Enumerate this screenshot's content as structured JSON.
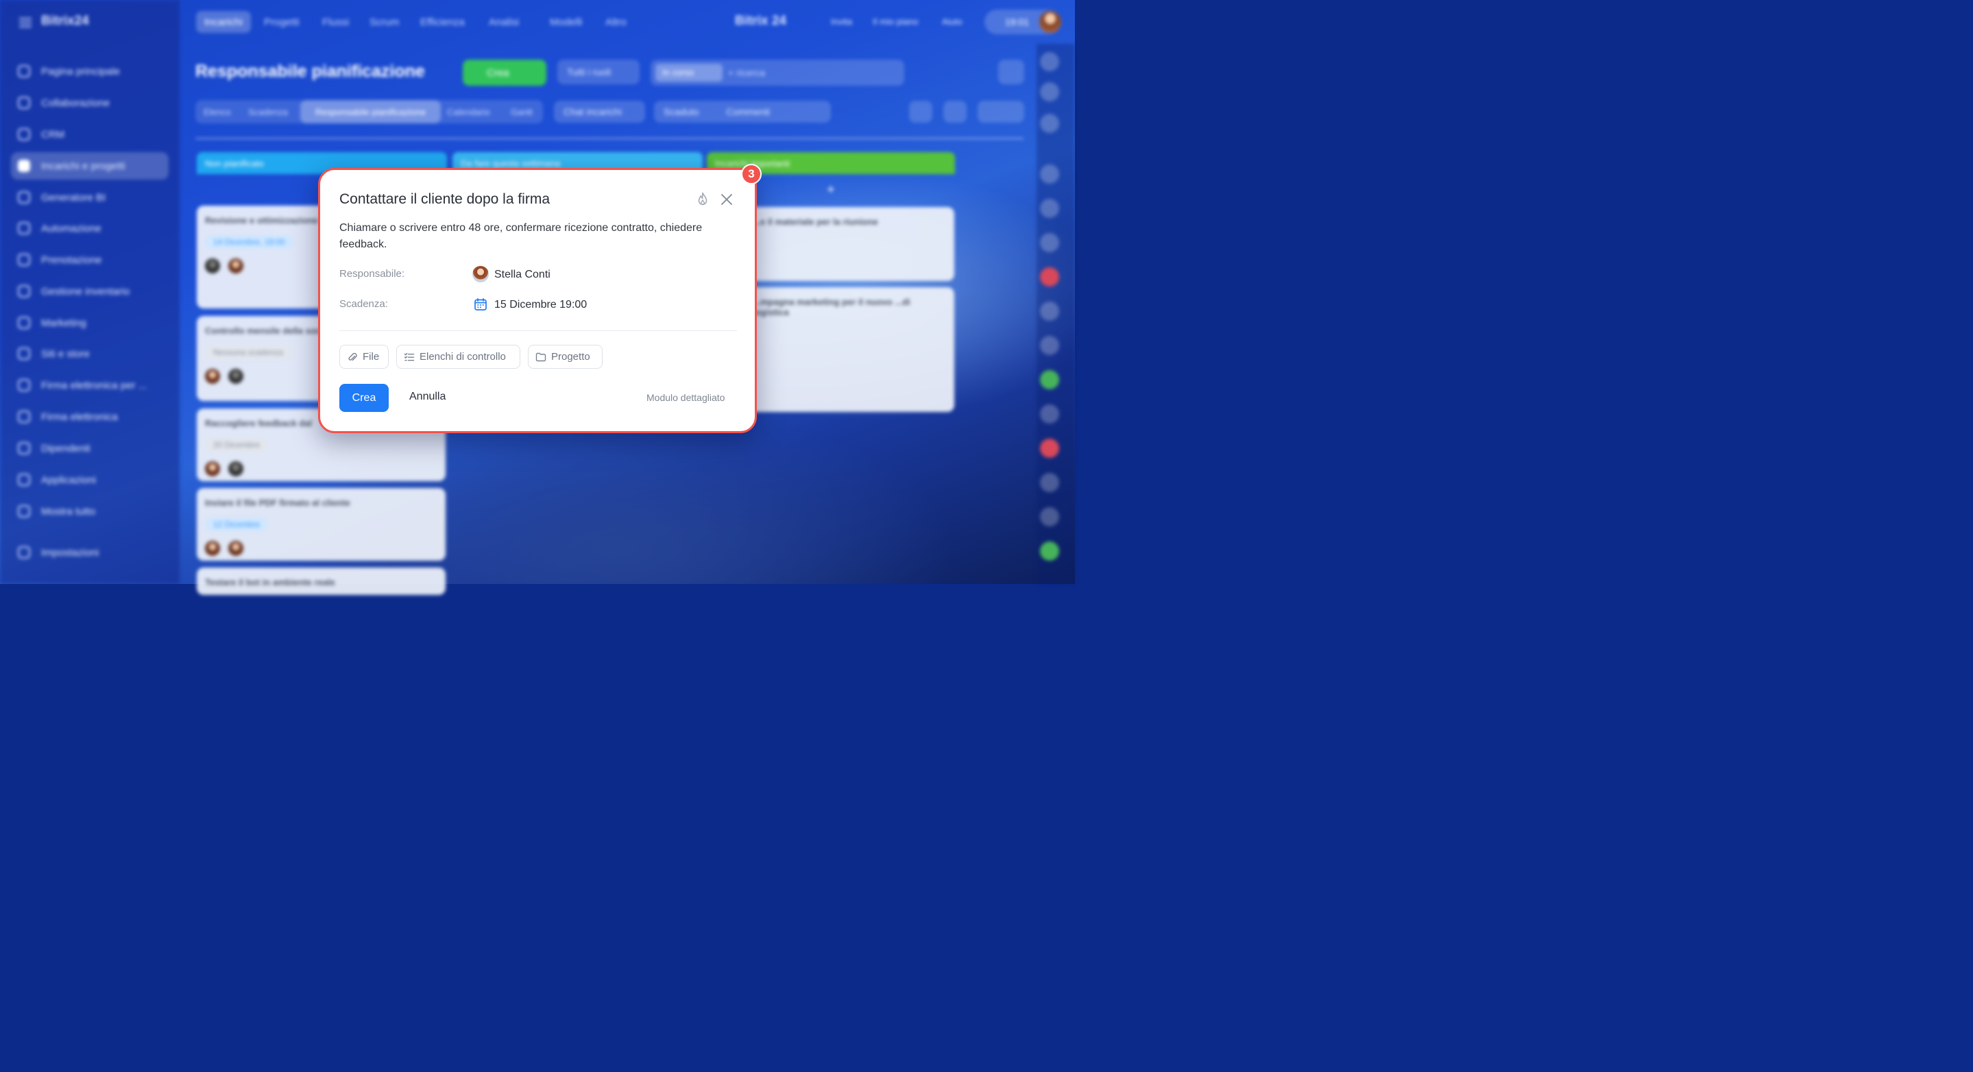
{
  "app": {
    "logo": "Bitrix24",
    "top_tabs": [
      "Incarichi",
      "Progetti",
      "Flussi",
      "Scrum",
      "Efficienza",
      "Analisi",
      "Modelli",
      "Altro"
    ],
    "top_right": {
      "brand": "Bitrix 24",
      "invite": "Invita",
      "plan": "Il mio piano",
      "help": "Aiuto",
      "time": "19:01"
    },
    "sidebar": [
      "Pagina principale",
      "Collaborazione",
      "CRM",
      "Incarichi e progetti",
      "Generatore BI",
      "Automazione",
      "Prenotazione",
      "Gestione inventario",
      "Marketing",
      "Siti e store",
      "Firma elettronica per ...",
      "Firma elettronica",
      "Dipendenti",
      "Applicazioni",
      "Mostra tutto",
      "Impostazioni"
    ],
    "page_title": "Responsabile pianificazione",
    "create_label": "Crea",
    "roles_label": "Tutti i ruoli",
    "filter_chip": "In corso",
    "search_placeholder": "+ ricerca",
    "view_tabs": [
      "Elenco",
      "Scadenza",
      "Responsabile pianificazione",
      "Calendario",
      "Gantt"
    ],
    "chat_label": "Chat incarichi",
    "counters": [
      "Scaduto",
      "Commenti"
    ],
    "columns": [
      "Non pianificato",
      "Da fare questa settimana",
      "Incarichi importanti"
    ],
    "cards": [
      {
        "title": "Revisione e ottimizzazione di agenzia",
        "date": "14 Dicembre, 19:00"
      },
      {
        "title": "Controllo mensile della social media",
        "date": "Nessuna scadenza"
      },
      {
        "title": "Raccogliere feedback dal",
        "date": "20 Dicembre"
      },
      {
        "title": "Inviare il file PDF firmato al cliente",
        "date": "12 Dicembre"
      },
      {
        "title": "Testare il bot in ambiente reale",
        "date": ""
      }
    ],
    "right_cards": [
      {
        "title": "...e il materiale per la riunione"
      },
      {
        "title": "...mpagna marketing per il nuovo ...di logistica"
      }
    ]
  },
  "popup": {
    "badge": "3",
    "title": "Contattare il cliente dopo la firma",
    "description": "Chiamare o scrivere entro 48 ore, confermare ricezione contratto, chiedere feedback.",
    "responsible_label": "Responsabile:",
    "responsible_name": "Stella Conti",
    "deadline_label": "Scadenza:",
    "deadline_value": "15 Dicembre 19:00",
    "chips": {
      "file": "File",
      "checklists": "Elenchi di controllo",
      "project": "Progetto"
    },
    "create_button": "Crea",
    "cancel_button": "Annulla",
    "detail_link": "Modulo dettagliato",
    "colors": {
      "outline": "#f2534d",
      "primary": "#1f7bf6"
    }
  }
}
